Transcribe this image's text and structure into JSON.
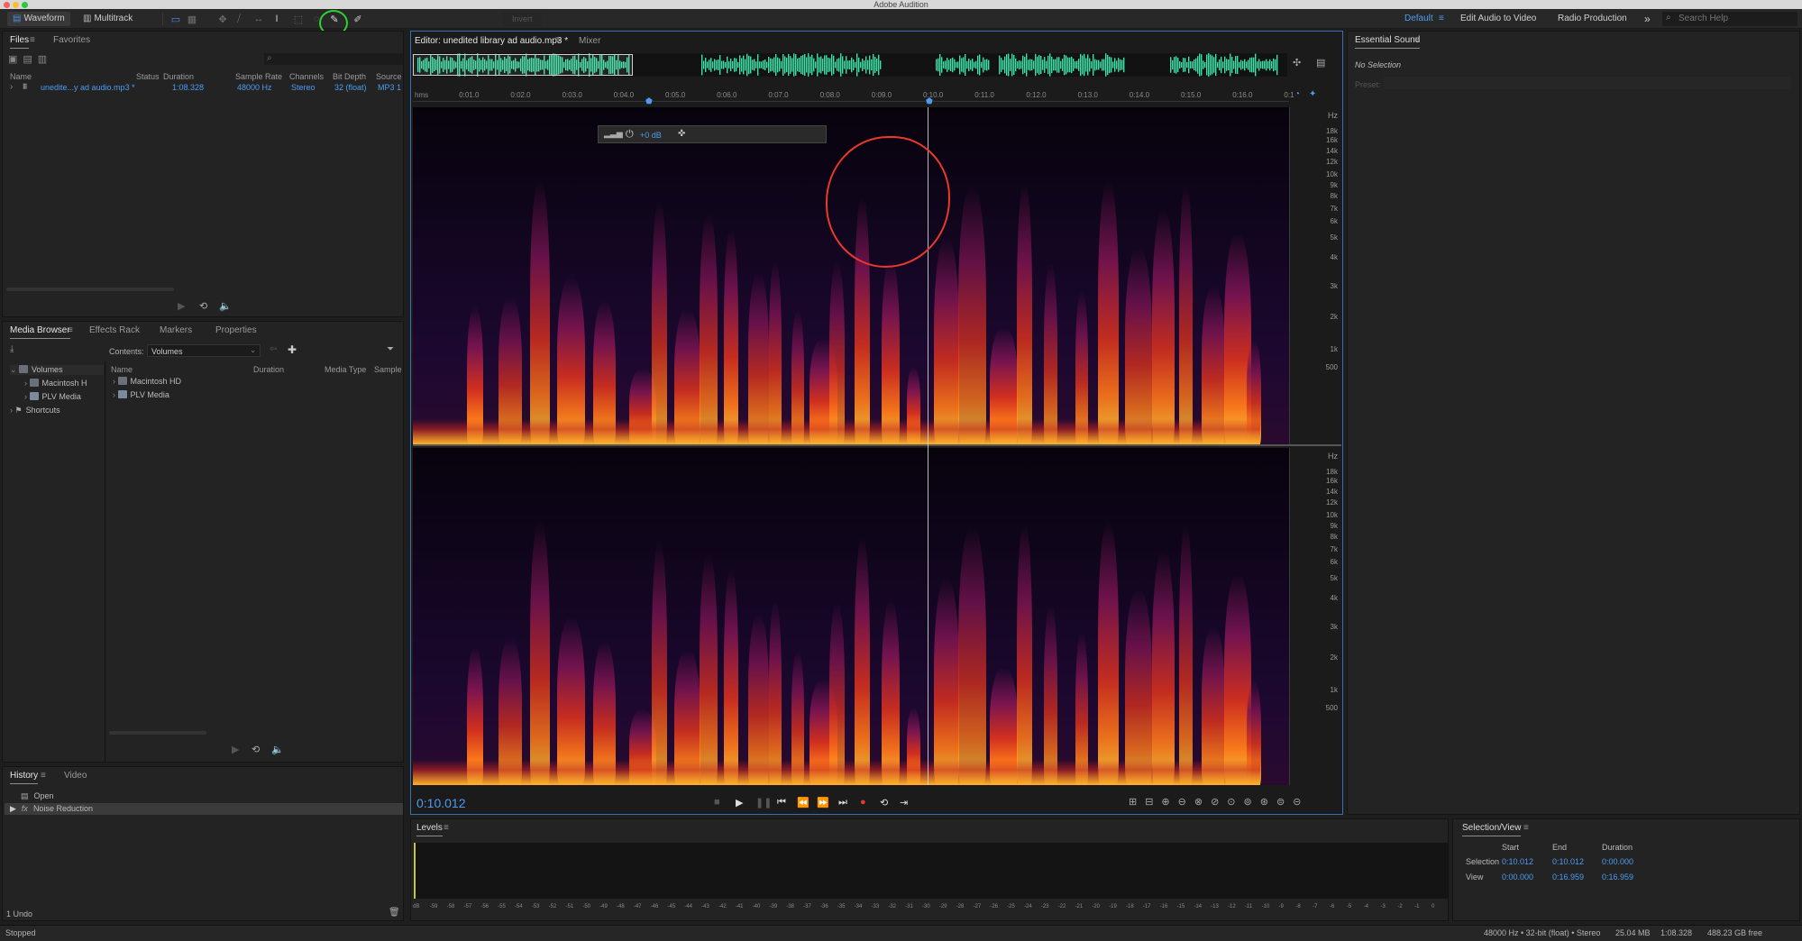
{
  "app": {
    "title": "Adobe Audition"
  },
  "toolbar": {
    "waveform_label": "Waveform",
    "multitrack_label": "Multitrack",
    "invert_label": "Invert",
    "workspaces": [
      "Default",
      "Edit Audio to Video",
      "Radio Production"
    ],
    "more_glyph": "»",
    "search_placeholder": "Search Help"
  },
  "files_panel": {
    "tabs": [
      "Files",
      "Favorites"
    ],
    "columns": [
      "Name",
      "Status",
      "Duration",
      "Sample Rate",
      "Channels",
      "Bit Depth",
      "Source"
    ],
    "row": {
      "name": "unedite...y ad audio.mp3 *",
      "status": "",
      "duration": "1:08.328",
      "sample_rate": "48000 Hz",
      "channels": "Stereo",
      "bit_depth": "32 (float)",
      "source": "MP3 1"
    }
  },
  "media_browser": {
    "tabs": [
      "Media Browser",
      "Effects Rack",
      "Markers",
      "Properties"
    ],
    "contents_label": "Contents:",
    "contents_value": "Volumes",
    "tree": [
      "Volumes",
      "Macintosh H",
      "PLV Media",
      "Shortcuts"
    ],
    "columns": [
      "Name",
      "Duration",
      "Media Type",
      "Sample"
    ],
    "items": [
      "Macintosh HD",
      "PLV Media"
    ]
  },
  "history": {
    "tabs": [
      "History",
      "Video"
    ],
    "items": [
      "Open",
      "Noise Reduction"
    ],
    "undo_count": "1 Undo"
  },
  "editor": {
    "tab_label": "Editor: unedited library ad audio.mp3 *",
    "mixer_label": "Mixer",
    "time_ticks": [
      "hms",
      "0:01.0",
      "0:02.0",
      "0:03.0",
      "0:04.0",
      "0:05.0",
      "0:06.0",
      "0:07.0",
      "0:08.0",
      "0:09.0",
      "0:10.0",
      "0:11.0",
      "0:12.0",
      "0:13.0",
      "0:14.0",
      "0:15.0",
      "0:16.0",
      "0:1"
    ],
    "hud_gain": "+0 dB",
    "freq_unit": "Hz",
    "freq_labels": [
      "18k",
      "16k",
      "14k",
      "12k",
      "10k",
      "9k",
      "8k",
      "7k",
      "6k",
      "5k",
      "4k",
      "3k",
      "2k",
      "1k",
      "500"
    ],
    "current_time": "0:10.012"
  },
  "essential_sound": {
    "title": "Essential Sound",
    "no_selection": "No Selection",
    "preset_label": "Preset:"
  },
  "levels": {
    "title": "Levels",
    "scale": [
      "dB",
      "-59",
      "-58",
      "-57",
      "-56",
      "-55",
      "-54",
      "-53",
      "-52",
      "-51",
      "-50",
      "-49",
      "-48",
      "-47",
      "-46",
      "-45",
      "-44",
      "-43",
      "-42",
      "-41",
      "-40",
      "-39",
      "-38",
      "-37",
      "-36",
      "-35",
      "-34",
      "-33",
      "-32",
      "-31",
      "-30",
      "-29",
      "-28",
      "-27",
      "-26",
      "-25",
      "-24",
      "-23",
      "-22",
      "-21",
      "-20",
      "-19",
      "-18",
      "-17",
      "-16",
      "-15",
      "-14",
      "-13",
      "-12",
      "-11",
      "-10",
      "-9",
      "-8",
      "-7",
      "-6",
      "-5",
      "-4",
      "-3",
      "-2",
      "-1",
      "0"
    ]
  },
  "selection_view": {
    "title": "Selection/View",
    "headers": [
      "Start",
      "End",
      "Duration"
    ],
    "selection_label": "Selection",
    "view_label": "View",
    "selection": [
      "0:10.012",
      "0:10.012",
      "0:00.000"
    ],
    "view": [
      "0:00.000",
      "0:16.959",
      "0:16.959"
    ]
  },
  "status": {
    "left": "Stopped",
    "format": "48000 Hz • 32-bit (float) • Stereo",
    "size": "25.04 MB",
    "duration": "1:08.328",
    "free": "488.23 GB free"
  },
  "colors": {
    "accent": "#4d9bf0",
    "playhead": "#e6e6e6",
    "annotation_red": "#e8392a",
    "annotation_green": "#2fd12f",
    "waveform": "#3fe0a8"
  }
}
